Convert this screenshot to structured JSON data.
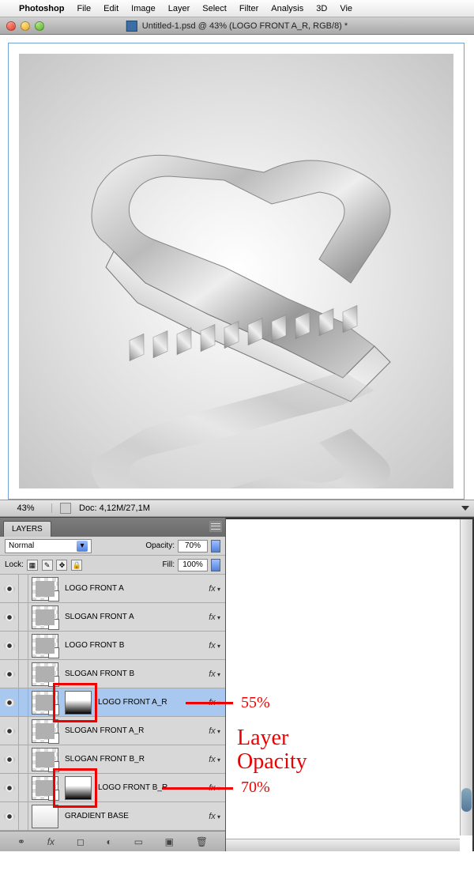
{
  "menubar": {
    "apple": "",
    "app": "Photoshop",
    "items": [
      "File",
      "Edit",
      "Image",
      "Layer",
      "Select",
      "Filter",
      "Analysis",
      "3D",
      "Vie"
    ]
  },
  "titlebar": {
    "title": "Untitled-1.psd @ 43% (LOGO FRONT A_R, RGB/8) *"
  },
  "statusbar": {
    "zoom": "43%",
    "doc": "Doc: 4,12M/27,1M"
  },
  "layers_panel": {
    "tab": "LAYERS",
    "blend_mode": "Normal",
    "opacity_label": "Opacity:",
    "opacity_value": "70%",
    "lock_label": "Lock:",
    "fill_label": "Fill:",
    "fill_value": "100%",
    "layers": [
      {
        "name": "LOGO FRONT A",
        "fx": "fx",
        "mask": false,
        "selected": false
      },
      {
        "name": "SLOGAN FRONT A",
        "fx": "fx",
        "mask": false,
        "selected": false
      },
      {
        "name": "LOGO FRONT B",
        "fx": "fx",
        "mask": false,
        "selected": false
      },
      {
        "name": "SLOGAN FRONT B",
        "fx": "fx",
        "mask": false,
        "selected": false
      },
      {
        "name": "LOGO FRONT A_R",
        "fx": "fx",
        "mask": true,
        "selected": true
      },
      {
        "name": "SLOGAN FRONT A_R",
        "fx": "fx",
        "mask": false,
        "selected": false
      },
      {
        "name": "SLOGAN FRONT B_R",
        "fx": "fx",
        "mask": false,
        "selected": false
      },
      {
        "name": "LOGO FRONT B_R",
        "fx": "fx",
        "mask": true,
        "selected": false
      },
      {
        "name": "GRADIENT BASE",
        "fx": "fx",
        "mask": false,
        "gradient": true,
        "selected": false
      }
    ]
  },
  "annotations": {
    "val1": "55%",
    "val2": "70%",
    "title_line1": "Layer",
    "title_line2": "Opacity"
  }
}
